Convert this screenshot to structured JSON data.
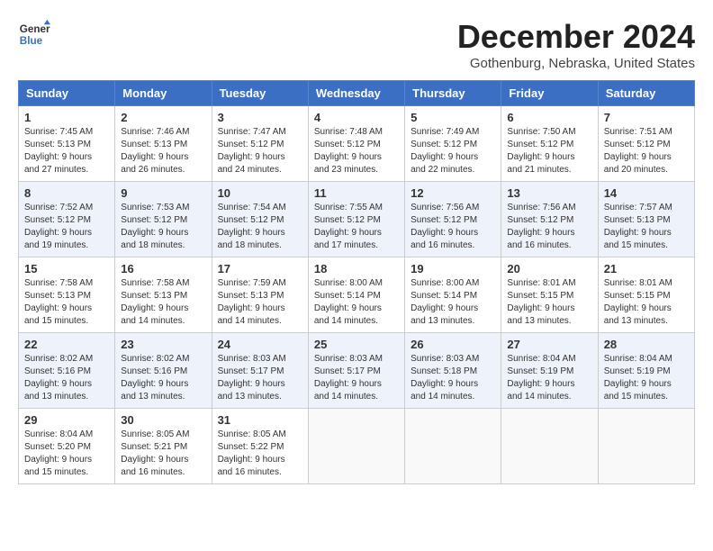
{
  "header": {
    "logo_general": "General",
    "logo_blue": "Blue",
    "month": "December 2024",
    "location": "Gothenburg, Nebraska, United States"
  },
  "weekdays": [
    "Sunday",
    "Monday",
    "Tuesday",
    "Wednesday",
    "Thursday",
    "Friday",
    "Saturday"
  ],
  "weeks": [
    [
      {
        "day": "1",
        "sunrise": "Sunrise: 7:45 AM",
        "sunset": "Sunset: 5:13 PM",
        "daylight": "Daylight: 9 hours and 27 minutes."
      },
      {
        "day": "2",
        "sunrise": "Sunrise: 7:46 AM",
        "sunset": "Sunset: 5:13 PM",
        "daylight": "Daylight: 9 hours and 26 minutes."
      },
      {
        "day": "3",
        "sunrise": "Sunrise: 7:47 AM",
        "sunset": "Sunset: 5:12 PM",
        "daylight": "Daylight: 9 hours and 24 minutes."
      },
      {
        "day": "4",
        "sunrise": "Sunrise: 7:48 AM",
        "sunset": "Sunset: 5:12 PM",
        "daylight": "Daylight: 9 hours and 23 minutes."
      },
      {
        "day": "5",
        "sunrise": "Sunrise: 7:49 AM",
        "sunset": "Sunset: 5:12 PM",
        "daylight": "Daylight: 9 hours and 22 minutes."
      },
      {
        "day": "6",
        "sunrise": "Sunrise: 7:50 AM",
        "sunset": "Sunset: 5:12 PM",
        "daylight": "Daylight: 9 hours and 21 minutes."
      },
      {
        "day": "7",
        "sunrise": "Sunrise: 7:51 AM",
        "sunset": "Sunset: 5:12 PM",
        "daylight": "Daylight: 9 hours and 20 minutes."
      }
    ],
    [
      {
        "day": "8",
        "sunrise": "Sunrise: 7:52 AM",
        "sunset": "Sunset: 5:12 PM",
        "daylight": "Daylight: 9 hours and 19 minutes."
      },
      {
        "day": "9",
        "sunrise": "Sunrise: 7:53 AM",
        "sunset": "Sunset: 5:12 PM",
        "daylight": "Daylight: 9 hours and 18 minutes."
      },
      {
        "day": "10",
        "sunrise": "Sunrise: 7:54 AM",
        "sunset": "Sunset: 5:12 PM",
        "daylight": "Daylight: 9 hours and 18 minutes."
      },
      {
        "day": "11",
        "sunrise": "Sunrise: 7:55 AM",
        "sunset": "Sunset: 5:12 PM",
        "daylight": "Daylight: 9 hours and 17 minutes."
      },
      {
        "day": "12",
        "sunrise": "Sunrise: 7:56 AM",
        "sunset": "Sunset: 5:12 PM",
        "daylight": "Daylight: 9 hours and 16 minutes."
      },
      {
        "day": "13",
        "sunrise": "Sunrise: 7:56 AM",
        "sunset": "Sunset: 5:12 PM",
        "daylight": "Daylight: 9 hours and 16 minutes."
      },
      {
        "day": "14",
        "sunrise": "Sunrise: 7:57 AM",
        "sunset": "Sunset: 5:13 PM",
        "daylight": "Daylight: 9 hours and 15 minutes."
      }
    ],
    [
      {
        "day": "15",
        "sunrise": "Sunrise: 7:58 AM",
        "sunset": "Sunset: 5:13 PM",
        "daylight": "Daylight: 9 hours and 15 minutes."
      },
      {
        "day": "16",
        "sunrise": "Sunrise: 7:58 AM",
        "sunset": "Sunset: 5:13 PM",
        "daylight": "Daylight: 9 hours and 14 minutes."
      },
      {
        "day": "17",
        "sunrise": "Sunrise: 7:59 AM",
        "sunset": "Sunset: 5:13 PM",
        "daylight": "Daylight: 9 hours and 14 minutes."
      },
      {
        "day": "18",
        "sunrise": "Sunrise: 8:00 AM",
        "sunset": "Sunset: 5:14 PM",
        "daylight": "Daylight: 9 hours and 14 minutes."
      },
      {
        "day": "19",
        "sunrise": "Sunrise: 8:00 AM",
        "sunset": "Sunset: 5:14 PM",
        "daylight": "Daylight: 9 hours and 13 minutes."
      },
      {
        "day": "20",
        "sunrise": "Sunrise: 8:01 AM",
        "sunset": "Sunset: 5:15 PM",
        "daylight": "Daylight: 9 hours and 13 minutes."
      },
      {
        "day": "21",
        "sunrise": "Sunrise: 8:01 AM",
        "sunset": "Sunset: 5:15 PM",
        "daylight": "Daylight: 9 hours and 13 minutes."
      }
    ],
    [
      {
        "day": "22",
        "sunrise": "Sunrise: 8:02 AM",
        "sunset": "Sunset: 5:16 PM",
        "daylight": "Daylight: 9 hours and 13 minutes."
      },
      {
        "day": "23",
        "sunrise": "Sunrise: 8:02 AM",
        "sunset": "Sunset: 5:16 PM",
        "daylight": "Daylight: 9 hours and 13 minutes."
      },
      {
        "day": "24",
        "sunrise": "Sunrise: 8:03 AM",
        "sunset": "Sunset: 5:17 PM",
        "daylight": "Daylight: 9 hours and 13 minutes."
      },
      {
        "day": "25",
        "sunrise": "Sunrise: 8:03 AM",
        "sunset": "Sunset: 5:17 PM",
        "daylight": "Daylight: 9 hours and 14 minutes."
      },
      {
        "day": "26",
        "sunrise": "Sunrise: 8:03 AM",
        "sunset": "Sunset: 5:18 PM",
        "daylight": "Daylight: 9 hours and 14 minutes."
      },
      {
        "day": "27",
        "sunrise": "Sunrise: 8:04 AM",
        "sunset": "Sunset: 5:19 PM",
        "daylight": "Daylight: 9 hours and 14 minutes."
      },
      {
        "day": "28",
        "sunrise": "Sunrise: 8:04 AM",
        "sunset": "Sunset: 5:19 PM",
        "daylight": "Daylight: 9 hours and 15 minutes."
      }
    ],
    [
      {
        "day": "29",
        "sunrise": "Sunrise: 8:04 AM",
        "sunset": "Sunset: 5:20 PM",
        "daylight": "Daylight: 9 hours and 15 minutes."
      },
      {
        "day": "30",
        "sunrise": "Sunrise: 8:05 AM",
        "sunset": "Sunset: 5:21 PM",
        "daylight": "Daylight: 9 hours and 16 minutes."
      },
      {
        "day": "31",
        "sunrise": "Sunrise: 8:05 AM",
        "sunset": "Sunset: 5:22 PM",
        "daylight": "Daylight: 9 hours and 16 minutes."
      },
      null,
      null,
      null,
      null
    ]
  ]
}
